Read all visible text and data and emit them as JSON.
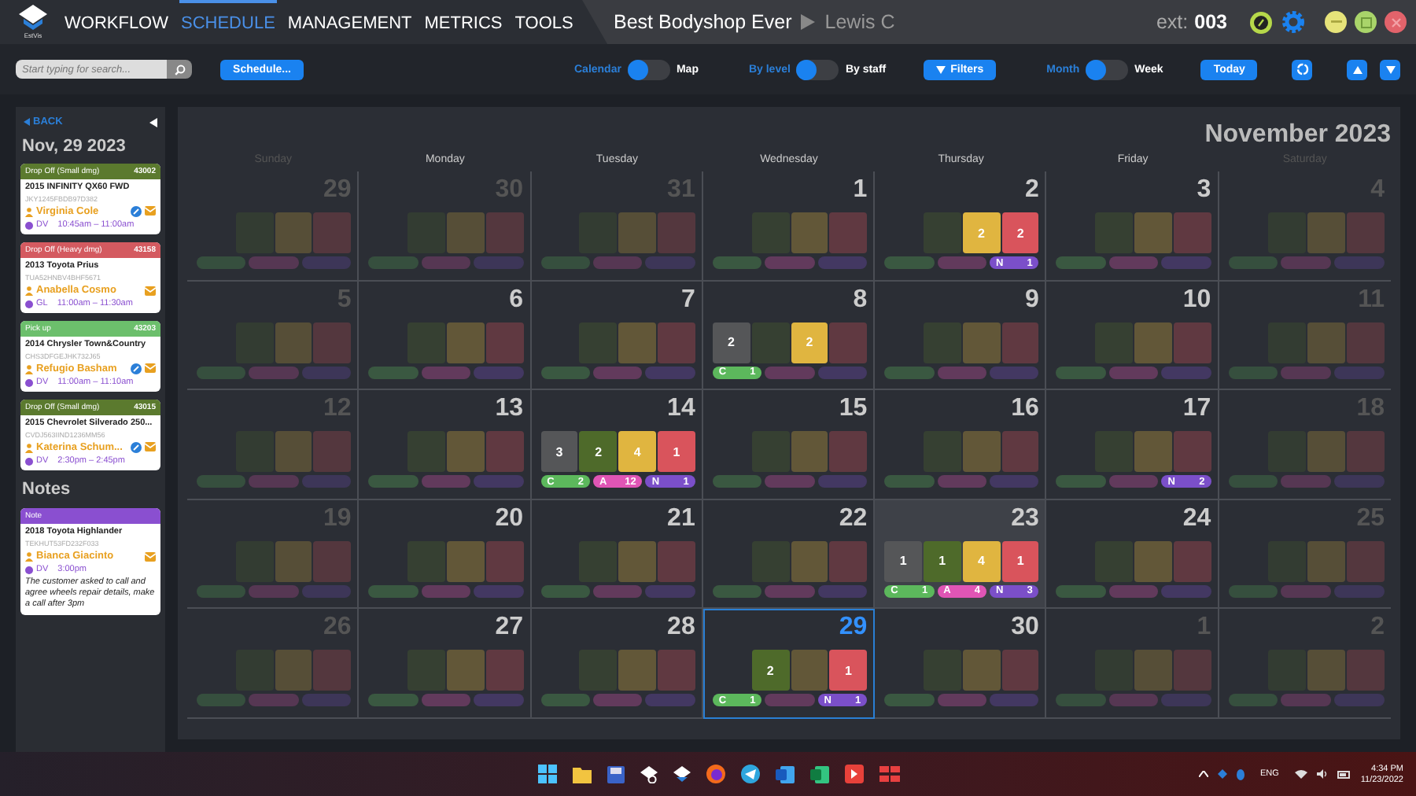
{
  "app": {
    "logo_text": "EstVis"
  },
  "nav": [
    {
      "label": "WORKFLOW",
      "selected": false
    },
    {
      "label": "SCHEDULE",
      "selected": true
    },
    {
      "label": "MANAGEMENT",
      "selected": false
    },
    {
      "label": "METRICS",
      "selected": false
    },
    {
      "label": "TOOLS",
      "selected": false
    }
  ],
  "header": {
    "shop": "Best Bodyshop Ever",
    "user": "Lewis C",
    "ext_label": "ext:",
    "ext": "003"
  },
  "toolbar": {
    "search": {
      "placeholder": "Start typing for search..."
    },
    "schedule_button": "Schedule...",
    "toggles": [
      {
        "left": "Calendar",
        "right": "Map",
        "right_selected": false
      },
      {
        "left": "By level",
        "right": "By staff",
        "right_selected": false
      },
      {
        "left": "Month",
        "right": "Week",
        "right_selected": false
      }
    ],
    "filters_button": "Filters",
    "today_button": "Today"
  },
  "sidebar": {
    "back": "BACK",
    "date": "Nov, 29 2023",
    "appointments": [
      {
        "type": "Drop Off (Small dmg)",
        "number": "43002",
        "color": "#5b7a2e",
        "vehicle": "2015 INFINITY QX60 FWD",
        "vin": "JKY1245FBDB97D382",
        "customer": "Virginia Cole",
        "chat": true,
        "tech": "DV",
        "time": "10:45am – 11:00am"
      },
      {
        "type": "Drop Off (Heavy dmg)",
        "number": "43158",
        "color": "#d45a60",
        "vehicle": "2013 Toyota Prius",
        "vin": "TUA52HNBV4BHF5671",
        "customer": "Anabella Cosmo",
        "chat": false,
        "tech": "GL",
        "time": "11:00am – 11:30am"
      },
      {
        "type": "Pick up",
        "number": "43203",
        "color": "#6cbf6c",
        "vehicle": "2014 Chrysler Town&Country",
        "vin": "CHS3DFGEJHK732J65",
        "customer": "Refugio Basham",
        "chat": true,
        "tech": "DV",
        "time": "11:00am – 11:10am"
      },
      {
        "type": "Drop Off (Small dmg)",
        "number": "43015",
        "color": "#5b7a2e",
        "vehicle": "2015 Chevrolet Silverado 250...",
        "vin": "CVDJ563IIND1236MM56",
        "customer": "Katerina Schum...",
        "chat": true,
        "tech": "DV",
        "time": "2:30pm – 2:45pm"
      }
    ],
    "notes_title": "Notes",
    "notes": [
      {
        "type": "Note",
        "color": "#8a4fd0",
        "vehicle": "2018 Toyota Highlander",
        "vin": "TEKHUT53FD232F033",
        "customer": "Bianca Giacinto",
        "tech": "DV",
        "time": "3:00pm",
        "text": "The customer asked to call and agree wheels repair details, make a call after 3pm"
      }
    ]
  },
  "calendar": {
    "title": "November 2023",
    "weekdays": [
      {
        "label": "Sunday",
        "muted": true
      },
      {
        "label": "Monday",
        "muted": false
      },
      {
        "label": "Tuesday",
        "muted": false
      },
      {
        "label": "Wednesday",
        "muted": false
      },
      {
        "label": "Thursday",
        "muted": false
      },
      {
        "label": "Friday",
        "muted": false
      },
      {
        "label": "Saturday",
        "muted": true
      }
    ],
    "weeks": [
      [
        {
          "day": "29",
          "muted": true
        },
        {
          "day": "30",
          "muted": true
        },
        {
          "day": "31",
          "muted": true
        },
        {
          "day": "1",
          "muted": false
        },
        {
          "day": "2",
          "muted": false,
          "blocks": [
            {
              "kind": "third",
              "count": "2"
            },
            {
              "kind": "fourth",
              "count": "2"
            }
          ],
          "tags": [
            {
              "kind": "third",
              "label": "N",
              "count": "1"
            }
          ]
        },
        {
          "day": "3",
          "muted": false
        },
        {
          "day": "4",
          "muted": true
        }
      ],
      [
        {
          "day": "5",
          "muted": true
        },
        {
          "day": "6",
          "muted": false
        },
        {
          "day": "7",
          "muted": false
        },
        {
          "day": "8",
          "muted": false,
          "blocks": [
            {
              "kind": "first",
              "count": "2"
            },
            {
              "kind": "third",
              "count": "2"
            }
          ],
          "tags": [
            {
              "kind": "first",
              "label": "C",
              "count": "1"
            }
          ]
        },
        {
          "day": "9",
          "muted": false
        },
        {
          "day": "10",
          "muted": false
        },
        {
          "day": "11",
          "muted": true
        }
      ],
      [
        {
          "day": "12",
          "muted": true
        },
        {
          "day": "13",
          "muted": false
        },
        {
          "day": "14",
          "muted": false,
          "blocks": [
            {
              "kind": "first",
              "count": "3"
            },
            {
              "kind": "second",
              "count": "2"
            },
            {
              "kind": "third",
              "count": "4"
            },
            {
              "kind": "fourth",
              "count": "1"
            }
          ],
          "tags": [
            {
              "kind": "first",
              "label": "C",
              "count": "2"
            },
            {
              "kind": "second",
              "label": "A",
              "count": "12"
            },
            {
              "kind": "third",
              "label": "N",
              "count": "1"
            }
          ]
        },
        {
          "day": "15",
          "muted": false
        },
        {
          "day": "16",
          "muted": false
        },
        {
          "day": "17",
          "muted": false,
          "tags": [
            {
              "kind": "third",
              "label": "N",
              "count": "2"
            }
          ]
        },
        {
          "day": "18",
          "muted": true
        }
      ],
      [
        {
          "day": "19",
          "muted": true
        },
        {
          "day": "20",
          "muted": false
        },
        {
          "day": "21",
          "muted": false
        },
        {
          "day": "22",
          "muted": false
        },
        {
          "day": "23",
          "muted": false,
          "highlighted": true,
          "blocks": [
            {
              "kind": "first",
              "count": "1"
            },
            {
              "kind": "second",
              "count": "1"
            },
            {
              "kind": "third",
              "count": "4"
            },
            {
              "kind": "fourth",
              "count": "1"
            }
          ],
          "tags": [
            {
              "kind": "first",
              "label": "C",
              "count": "1"
            },
            {
              "kind": "second",
              "label": "A",
              "count": "4"
            },
            {
              "kind": "third",
              "label": "N",
              "count": "3"
            }
          ]
        },
        {
          "day": "24",
          "muted": false
        },
        {
          "day": "25",
          "muted": true
        }
      ],
      [
        {
          "day": "26",
          "muted": true
        },
        {
          "day": "27",
          "muted": false
        },
        {
          "day": "28",
          "muted": false
        },
        {
          "day": "29",
          "muted": false,
          "selected": true,
          "blocks": [
            {
              "kind": "second",
              "count": "2"
            },
            {
              "kind": "fourth",
              "count": "1"
            }
          ],
          "tags": [
            {
              "kind": "first",
              "label": "C",
              "count": "1"
            },
            {
              "kind": "third",
              "label": "N",
              "count": "1"
            }
          ]
        },
        {
          "day": "30",
          "muted": false
        },
        {
          "day": "1",
          "muted": true
        },
        {
          "day": "2",
          "muted": true
        }
      ]
    ]
  },
  "taskbar": {
    "language": "ENG",
    "time": "4:34 PM",
    "date": "11/23/2022"
  }
}
